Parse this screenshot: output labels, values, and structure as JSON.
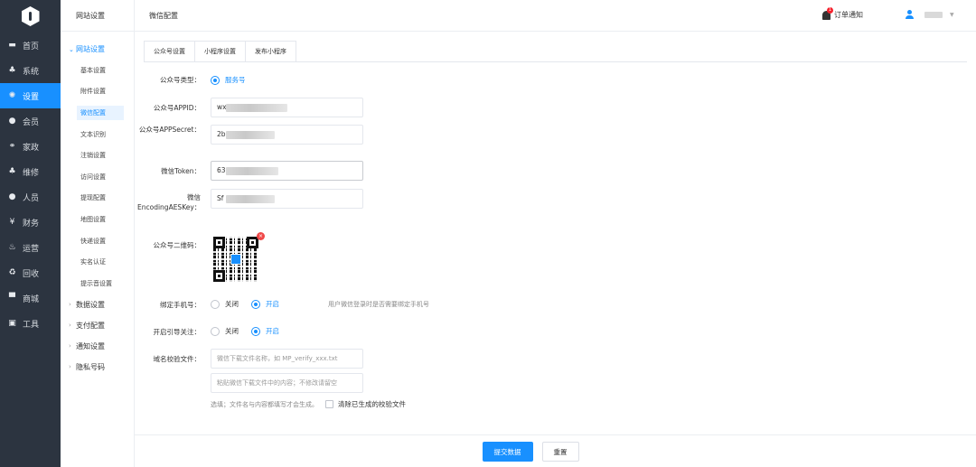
{
  "nav": {
    "items": [
      {
        "label": "首页",
        "icon": "monitor-icon"
      },
      {
        "label": "系统",
        "icon": "sitemap-icon"
      },
      {
        "label": "设置",
        "icon": "gear-icon"
      },
      {
        "label": "会员",
        "icon": "user-icon"
      },
      {
        "label": "家政",
        "icon": "link-icon"
      },
      {
        "label": "维修",
        "icon": "sitemap-icon"
      },
      {
        "label": "人员",
        "icon": "user-icon"
      },
      {
        "label": "财务",
        "icon": "yen-icon"
      },
      {
        "label": "运营",
        "icon": "fire-icon"
      },
      {
        "label": "回收",
        "icon": "recycle-icon"
      },
      {
        "label": "商城",
        "icon": "store-icon"
      },
      {
        "label": "工具",
        "icon": "briefcase-icon"
      }
    ],
    "active": "设置"
  },
  "subnav": {
    "header": "网站设置",
    "group_open": "网站设置",
    "items": [
      "基本设置",
      "附件设置",
      "微信配置",
      "文本识别",
      "注销设置",
      "访问设置",
      "提现配置",
      "地图设置",
      "快递设置",
      "实名认证",
      "提示音设置"
    ],
    "active_item": "微信配置",
    "groups_closed": [
      "数据设置",
      "支付配置",
      "通知设置",
      "隐私号码"
    ]
  },
  "topbar": {
    "title": "微信配置",
    "notice_label": "订单通知",
    "notice_badge": "1"
  },
  "tabs": [
    "公众号设置",
    "小程序设置",
    "发布小程序"
  ],
  "form": {
    "type_label": "公众号类型：",
    "type_value": "服务号",
    "appid_label": "公众号APPID：",
    "appid_prefix": "wx",
    "secret_label": "公众号APPSecret：",
    "secret_prefix": "2b",
    "token_label": "微信Token：",
    "token_prefix": "63",
    "aeskey_label": "微信EncodingAESKey：",
    "aeskey_prefix": "Sf",
    "qr_label": "公众号二维码：",
    "bind_label": "绑定手机号：",
    "bind_off": "关闭",
    "bind_on": "开启",
    "bind_hint": "用户微信登录时是否需要绑定手机号",
    "follow_label": "开启引导关注：",
    "follow_off": "关闭",
    "follow_on": "开启",
    "domain_label": "域名校验文件：",
    "domain_filename_placeholder": "微信下载文件名称，如 MP_verify_xxx.txt",
    "domain_content_placeholder": "粘贴微信下载文件中的内容；不修改请留空",
    "domain_hint": "选填；文件名与内容都填写才会生成。",
    "clear_label": "清除已生成的校验文件"
  },
  "footer": {
    "submit": "提交数据",
    "reset": "重置"
  },
  "colors": {
    "accent": "#1890ff",
    "nav_bg": "#2c3440"
  }
}
